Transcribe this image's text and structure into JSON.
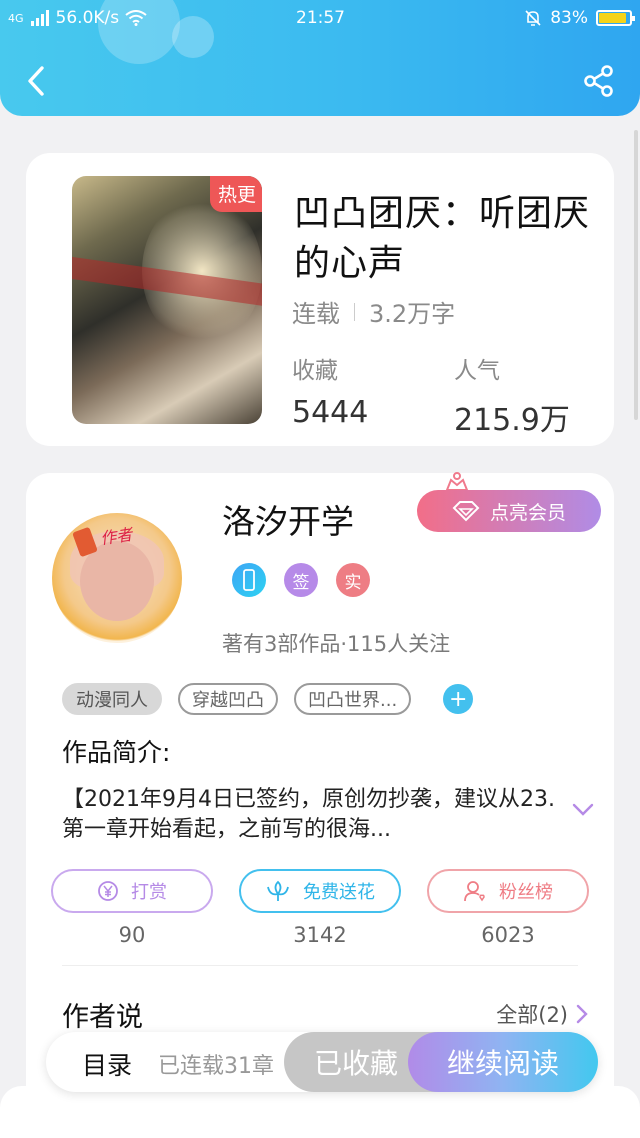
{
  "status_bar": {
    "network": "4G",
    "speed": "56.0K/s",
    "time": "21:57",
    "battery": "83%",
    "battery_level": 0.83
  },
  "book": {
    "hot_badge": "热更",
    "title": "凹凸团厌：听团厌的心声",
    "status": "连载",
    "word_count": "3.2万字",
    "favorites_label": "收藏",
    "favorites_value": "5444",
    "popularity_label": "人气",
    "popularity_value": "215.9万"
  },
  "author": {
    "avatar_tag": "作者",
    "name": "洛汐开学",
    "vip_label": "点亮会员",
    "badges": [
      "签",
      "实"
    ],
    "stats": "著有3部作品·115人关注",
    "tags": [
      "动漫同人",
      "穿越凹凸",
      "凹凸世界..."
    ],
    "add_tag": "+"
  },
  "intro": {
    "title": "作品简介:",
    "text": "【2021年9月4日已签约，原创勿抄袭，建议从23.第一章开始看起，之前写的很海..."
  },
  "actions": [
    {
      "label": "打赏",
      "count": "90",
      "icon": "yen-coin-icon",
      "color": "#b58ae6"
    },
    {
      "label": "免费送花",
      "count": "3142",
      "icon": "flower-icon",
      "color": "#43c0ee"
    },
    {
      "label": "粉丝榜",
      "count": "6023",
      "icon": "fan-user-icon",
      "color": "#ef7d85"
    }
  ],
  "author_says": {
    "title": "作者说",
    "all_label": "全部(2)"
  },
  "bottom_bar": {
    "toc_label": "目录",
    "toc_status": "已连载31章",
    "favorited_label": "已收藏",
    "continue_label": "继续阅读"
  },
  "colors": {
    "header_start": "#48c9ee",
    "header_end": "#2fa6f0",
    "hot_badge": "#ee5757",
    "vip_start": "#f26e88",
    "vip_end": "#b08ce6"
  }
}
